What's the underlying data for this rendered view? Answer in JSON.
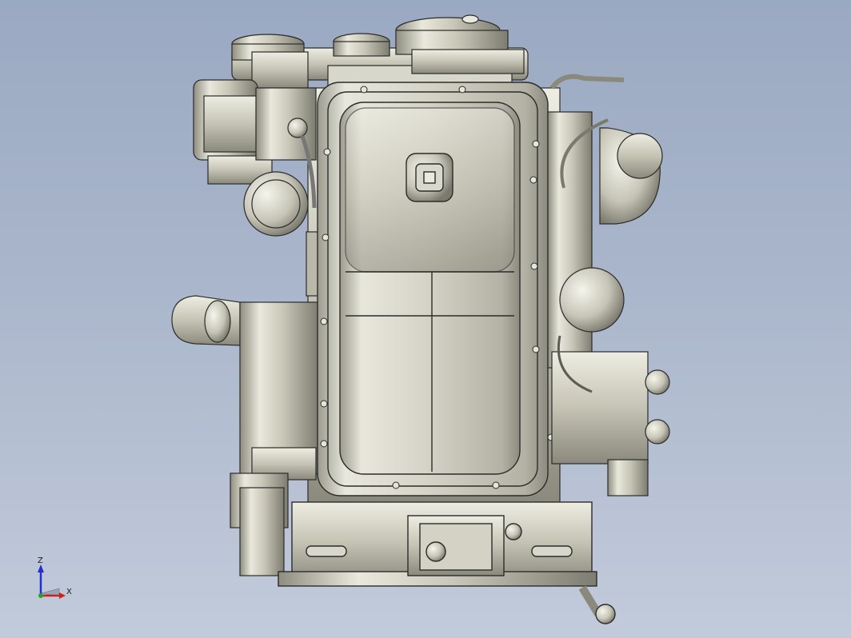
{
  "viewport": {
    "background_top": "#9aa9c2",
    "background_bottom": "#c2cbdb",
    "model_metal_color": "#c9c8bb",
    "model_edge_color": "#2b2b2b"
  },
  "triad": {
    "z_label": "Z",
    "x_label": "X",
    "z_axis_color": "#1f2fd0",
    "x_axis_color": "#d01f1f",
    "y_axis_color": "#2aa02a"
  }
}
